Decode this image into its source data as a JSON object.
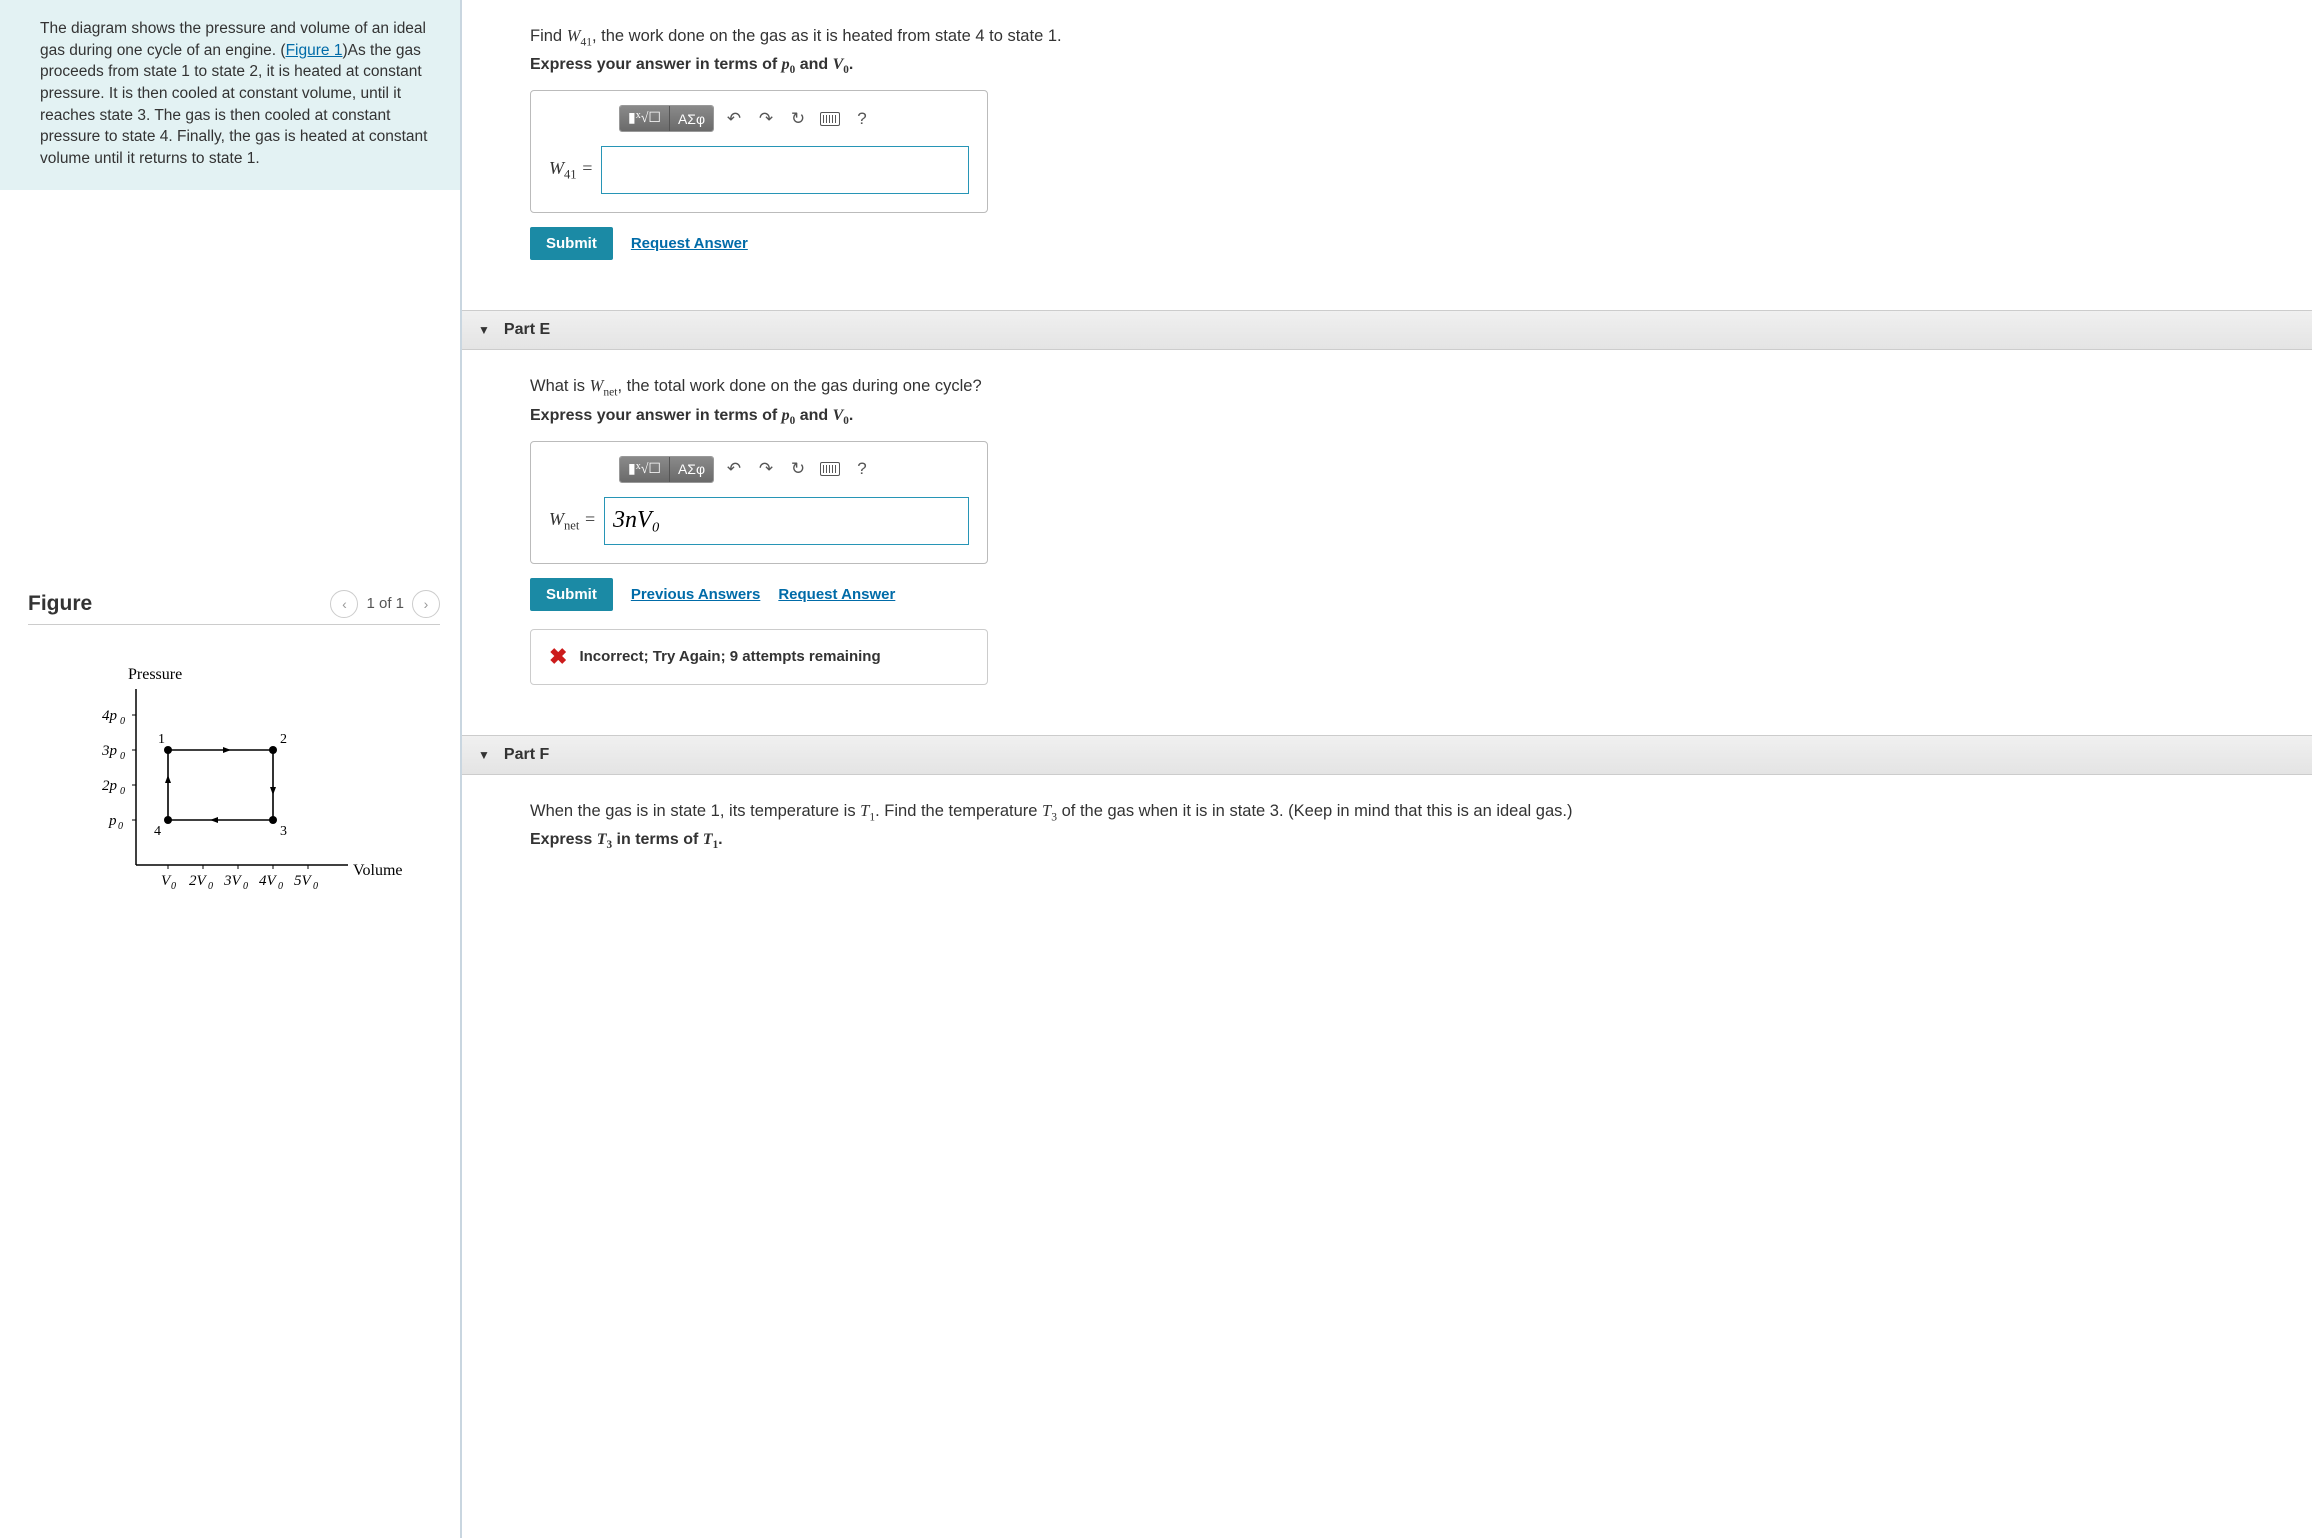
{
  "problem": {
    "text_a": "The diagram shows the pressure and volume of an ideal gas during one cycle of an engine. (",
    "figure_link": "Figure 1",
    "text_b": ")As the gas proceeds from state 1 to state 2, it is heated at constant pressure. It is then cooled at constant volume, until it reaches state 3. The gas is then cooled at constant pressure to state 4. Finally, the gas is heated at constant volume until it returns to state 1."
  },
  "figure": {
    "heading": "Figure",
    "pager": "1 of 1",
    "ylabel": "Pressure",
    "xlabel": "Volume",
    "yticks": [
      "4p₀",
      "3p₀",
      "2p₀",
      "p₀"
    ],
    "xticks": [
      "V₀",
      "2V₀",
      "3V₀",
      "4V₀",
      "5V₀"
    ],
    "points": {
      "p1": "1",
      "p2": "2",
      "p3": "3",
      "p4": "4"
    }
  },
  "partD": {
    "question_a": "Find ",
    "question_var": "W",
    "question_sub": "41",
    "question_b": ", the work done on the gas as it is heated from state 4 to state 1.",
    "express": "Express your answer in terms of ",
    "express_p": "p",
    "express_psub": "0",
    "express_and": " and ",
    "express_v": "V",
    "express_vsub": "0",
    "express_end": ".",
    "eq_lhs": "W",
    "eq_sub": "41",
    "eq_equals": " =",
    "value": "",
    "submit": "Submit",
    "request": "Request Answer"
  },
  "partE": {
    "header": "Part E",
    "question_a": "What is ",
    "question_var": "W",
    "question_sub": "net",
    "question_b": ", the total work done on the gas during one cycle?",
    "express": "Express your answer in terms of ",
    "express_p": "p",
    "express_psub": "0",
    "express_and": " and ",
    "express_v": "V",
    "express_vsub": "0",
    "express_end": ".",
    "eq_lhs": "W",
    "eq_sub": "net",
    "eq_equals": " =",
    "value": "3nV₀",
    "submit": "Submit",
    "previous": "Previous Answers",
    "request": "Request Answer",
    "feedback": "Incorrect; Try Again; 9 attempts remaining"
  },
  "partF": {
    "header": "Part F",
    "question_a": "When the gas is in state 1, its temperature is ",
    "t1": "T",
    "t1sub": "1",
    "question_b": ". Find the temperature ",
    "t3": "T",
    "t3sub": "3",
    "question_c": " of the gas when it is in state 3. (Keep in mind that this is an ideal gas.)",
    "express_a": "Express ",
    "express_t3": "T",
    "express_t3sub": "3",
    "express_b": " in terms of ",
    "express_t1": "T",
    "express_t1sub": "1",
    "express_c": "."
  },
  "toolbar": {
    "templates_label": "x√☐",
    "greek_label": "ΑΣφ",
    "undo": "↶",
    "redo": "↷",
    "reset": "↻",
    "help": "?"
  },
  "chart_data": {
    "type": "line",
    "title": "",
    "xlabel": "Volume",
    "ylabel": "Pressure",
    "xticks": [
      "V0",
      "2V0",
      "3V0",
      "4V0",
      "5V0"
    ],
    "yticks": [
      "p0",
      "2p0",
      "3p0",
      "4p0"
    ],
    "xlim": [
      0,
      5.5
    ],
    "ylim": [
      0,
      4.5
    ],
    "series": [
      {
        "name": "cycle",
        "points": [
          {
            "label": "1",
            "x": 1,
            "y": 3
          },
          {
            "label": "2",
            "x": 4,
            "y": 3
          },
          {
            "label": "3",
            "x": 4,
            "y": 1
          },
          {
            "label": "4",
            "x": 1,
            "y": 1
          }
        ],
        "closed": true,
        "direction": "1→2→3→4→1"
      }
    ]
  }
}
